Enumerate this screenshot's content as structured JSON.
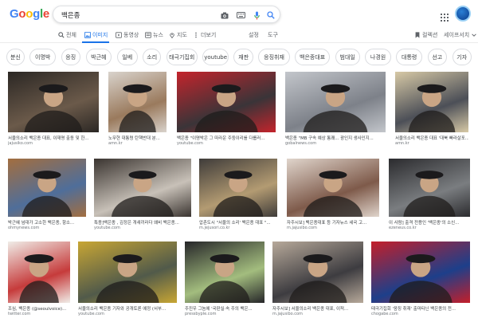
{
  "logo": {
    "letters": [
      "G",
      "o",
      "o",
      "g",
      "l",
      "e"
    ],
    "colors": [
      "#4285f4",
      "#ea4335",
      "#fbbc05",
      "#4285f4",
      "#34a853",
      "#ea4335"
    ]
  },
  "search": {
    "query": "백은종",
    "icons": [
      "camera-icon",
      "keyboard-icon",
      "microphone-icon",
      "search-icon"
    ]
  },
  "header": {
    "apps_icon": "apps-grid-icon",
    "avatar_color": "#1a5fb4"
  },
  "tabs": {
    "items": [
      {
        "label": "전체",
        "icon": "search-icon"
      },
      {
        "label": "이미지",
        "icon": "image-icon",
        "active": true
      },
      {
        "label": "동영상",
        "icon": "video-icon"
      },
      {
        "label": "뉴스",
        "icon": "news-icon"
      },
      {
        "label": "지도",
        "icon": "map-pin-icon"
      },
      {
        "label": "더보기",
        "icon": "more-icon"
      }
    ],
    "settings": "설정",
    "tools": "도구",
    "collections": "컬렉션",
    "safesearch": "세이프서치"
  },
  "chips": [
    "분신",
    "이명박",
    "응징",
    "박근혜",
    "일베",
    "소리",
    "태극기집회",
    "youtube",
    "재판",
    "응징취재",
    "백은종대표",
    "범대일",
    "나경원",
    "대통령",
    "선고",
    "기자"
  ],
  "results": [
    {
      "caption": "서울의소리 백은종 대표, 이재명 출동 및 한...",
      "source": "jajusiko.com",
      "colors": [
        "#6b5a4a",
        "#2b2724"
      ]
    },
    {
      "caption": "노무현 대통령 탄핵반대 분...",
      "source": "amn.kr",
      "colors": [
        "#9a7a5d",
        "#d9d3cc"
      ]
    },
    {
      "caption": "백은종 \"이명박은 그 따라운 주둥이리를 다룹러...",
      "source": "youtube.com",
      "colors": [
        "#3a3438",
        "#c4242c"
      ]
    },
    {
      "caption": "백은종 \"MB 구속 예상 통쾌... 광인지 생사인지...",
      "source": "gobalnews.com",
      "colors": [
        "#7d8189",
        "#c3c6cb"
      ]
    },
    {
      "caption": "서울의소리 백은종 대표 '대북 빠라살포...",
      "source": "amn.kr",
      "colors": [
        "#4c4f57",
        "#d7c9a6"
      ]
    },
    {
      "caption": "박근혜 넘대가 고소한 백은종, 항소...",
      "source": "ohmynews.com",
      "colors": [
        "#4f6e9a",
        "#a36e3f"
      ]
    },
    {
      "caption": "특종]백은종 , 김정은 개새끼라다 왜비 백은종...",
      "source": "youtube.com",
      "colors": [
        "#c8c1b8",
        "#3a3430"
      ]
    },
    {
      "caption": "압촌도시 \"서울의 소리' 백은종 대표 \"...",
      "source": "m.jejusori.co.kr",
      "colors": [
        "#b39b72",
        "#3f3c3a"
      ]
    },
    {
      "caption": "자주시보] 백은종대표 등 기자뉴스 세국 고...",
      "source": "m.jajusibo.com",
      "colors": [
        "#7e5a4a",
        "#e0d5cc"
      ]
    },
    {
      "caption": "이 사람] 출격 전용인 '백은종'의 소신...",
      "source": "ezeneus.co.kr",
      "colors": [
        "#7a7d80",
        "#2b2b2e"
      ]
    },
    {
      "caption": "조심, 백은종 (@seoulvoice)...",
      "source": "twitter.com",
      "colors": [
        "#c63b3b",
        "#f0ede8"
      ]
    },
    {
      "caption": "서울의소리 백은종 기자와 공개토론 예정 (서부...",
      "source": "youtube.com",
      "colors": [
        "#515a4a",
        "#c8a634"
      ]
    },
    {
      "caption": "주진우 그놈에 '국판실·속 주의 백은...",
      "source": "pressbyple.com",
      "colors": [
        "#a3bd7e",
        "#262629"
      ]
    },
    {
      "caption": "자주시보] 서울의소리 백은종 대표, 이적...",
      "source": "m.jajusibo.com",
      "colors": [
        "#3d3c40",
        "#b7a99a"
      ]
    },
    {
      "caption": "태극기집회 '응징 취재' 출마타닌 백은종의 전...",
      "source": "chogabe.com",
      "colors": [
        "#1d3f8a",
        "#c41f2a"
      ]
    }
  ]
}
